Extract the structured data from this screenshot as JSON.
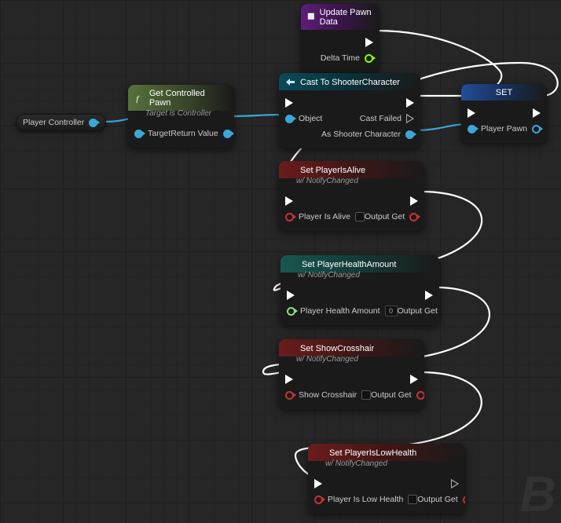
{
  "nodes": {
    "updatePawn": {
      "title": "Update Pawn Data",
      "pins": {
        "deltaTime": "Delta Time"
      }
    },
    "getControlledPawn": {
      "title": "Get Controlled Pawn",
      "subtitle": "Target is Controller",
      "pins": {
        "target": "Target",
        "returnValue": "Return Value"
      }
    },
    "playerController": {
      "label": "Player Controller"
    },
    "cast": {
      "title": "Cast To ShooterCharacter",
      "pins": {
        "object": "Object",
        "castFailed": "Cast Failed",
        "asShooter": "As Shooter Character"
      }
    },
    "setVar": {
      "title": "SET",
      "pins": {
        "playerPawn": "Player Pawn"
      }
    },
    "setAlive": {
      "title": "Set PlayerIsAlive",
      "subtitle": "w/ NotifyChanged",
      "pins": {
        "playerIsAlive": "Player Is Alive",
        "outputGet": "Output Get"
      }
    },
    "setHealth": {
      "title": "Set PlayerHealthAmount",
      "subtitle": "w/ NotifyChanged",
      "pins": {
        "amount": "Player Health Amount",
        "amountDefault": "0",
        "outputGet": "Output Get"
      }
    },
    "setCrosshair": {
      "title": "Set ShowCrosshair",
      "subtitle": "w/ NotifyChanged",
      "pins": {
        "show": "Show Crosshair",
        "outputGet": "Output Get"
      }
    },
    "setLowHealth": {
      "title": "Set PlayerIsLowHealth",
      "subtitle": "w/ NotifyChanged",
      "pins": {
        "low": "Player Is Low Health",
        "outputGet": "Output Get"
      }
    }
  }
}
